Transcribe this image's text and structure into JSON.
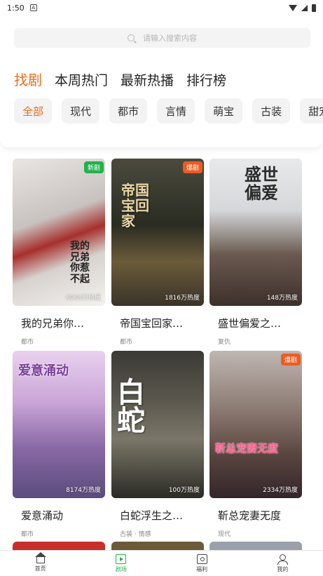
{
  "status_bar": {
    "time": "1:50",
    "notif_letter": "A"
  },
  "search": {
    "placeholder": "请输入搜索内容"
  },
  "main_tabs": [
    "找剧",
    "本周热门",
    "最新热播",
    "排行榜"
  ],
  "categories": [
    "全部",
    "现代",
    "都市",
    "言情",
    "萌宝",
    "古装",
    "甜宠"
  ],
  "dramas": [
    {
      "title": "我的兄弟你…",
      "tag": "都市",
      "heat": "6968万热度",
      "badge": "新剧",
      "poster_text": "我的兄弟你惹不起"
    },
    {
      "title": "帝国宝回家…",
      "tag": "都市",
      "heat": "1816万热度",
      "badge": "爆剧",
      "poster_text": "帝国宝回家"
    },
    {
      "title": "盛世偏爱之…",
      "tag": "复仇",
      "heat": "148万热度",
      "badge": "",
      "poster_text": "盛世偏爱"
    },
    {
      "title": "爱意涌动",
      "tag": "都市",
      "heat": "8174万热度",
      "badge": "",
      "poster_text": "爱意涌动"
    },
    {
      "title": "白蛇浮生之…",
      "tag": "古装 · 情感",
      "heat": "100万热度",
      "badge": "",
      "poster_text": "白蛇"
    },
    {
      "title": "靳总宠妻无度",
      "tag": "现代",
      "heat": "2334万热度",
      "badge": "爆剧",
      "poster_text": "靳总宠妻无度"
    }
  ],
  "bottom_nav": [
    {
      "label": "首页",
      "icon": "home-icon"
    },
    {
      "label": "剧场",
      "icon": "play-icon"
    },
    {
      "label": "福利",
      "icon": "gift-icon"
    },
    {
      "label": "我的",
      "icon": "user-icon"
    }
  ],
  "colors": {
    "accent": "#ef6b1c",
    "green": "#22b14c",
    "hot_badge": "#ee5b22"
  }
}
